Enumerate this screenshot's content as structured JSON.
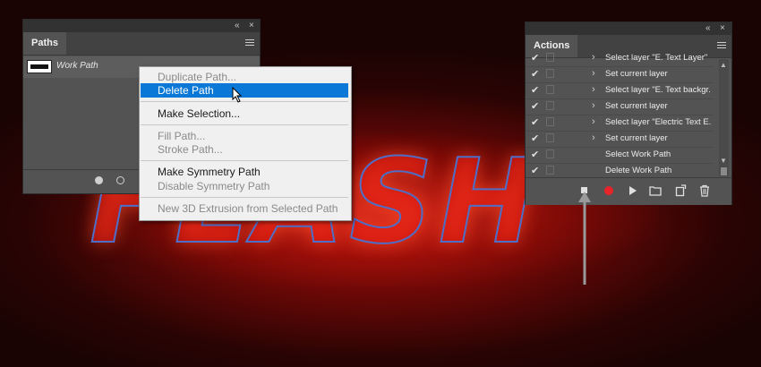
{
  "canvas": {
    "text": "FLASH"
  },
  "paths_panel": {
    "tab_label": "Paths",
    "collapse_glyph": "«",
    "close_glyph": "×",
    "work_path_label": "Work Path"
  },
  "context_menu": {
    "items": [
      {
        "label": "Duplicate Path...",
        "state": "disabled"
      },
      {
        "label": "Delete Path",
        "state": "selected"
      },
      {
        "label": "Make Selection...",
        "state": "enabled"
      },
      {
        "label": "Fill Path...",
        "state": "disabled"
      },
      {
        "label": "Stroke Path...",
        "state": "disabled"
      },
      {
        "label": "Make Symmetry Path",
        "state": "enabled"
      },
      {
        "label": "Disable Symmetry Path",
        "state": "disabled"
      },
      {
        "label": "New 3D Extrusion from Selected Path",
        "state": "disabled"
      }
    ]
  },
  "actions_panel": {
    "tab_label": "Actions",
    "collapse_glyph": "«",
    "close_glyph": "×",
    "check_glyph": "✔",
    "chevron_glyph": "›",
    "rows": [
      {
        "label": "Select layer \"E. Text Layer\"",
        "has_chevron": true
      },
      {
        "label": "Set current layer",
        "has_chevron": true
      },
      {
        "label": "Select layer \"E. Text backgr...",
        "has_chevron": true
      },
      {
        "label": "Set current layer",
        "has_chevron": true
      },
      {
        "label": "Select layer \"Electric Text E...",
        "has_chevron": true
      },
      {
        "label": "Set current layer",
        "has_chevron": true
      },
      {
        "label": "Select Work Path",
        "has_chevron": false
      },
      {
        "label": "Delete Work Path",
        "has_chevron": false
      }
    ],
    "footer_icons": [
      "stop-icon",
      "record-icon",
      "play-icon",
      "folder-icon",
      "new-action-icon",
      "trash-icon"
    ]
  },
  "colors": {
    "selection": "#0a78d7",
    "record": "#e8232a",
    "panel": "#535353"
  }
}
